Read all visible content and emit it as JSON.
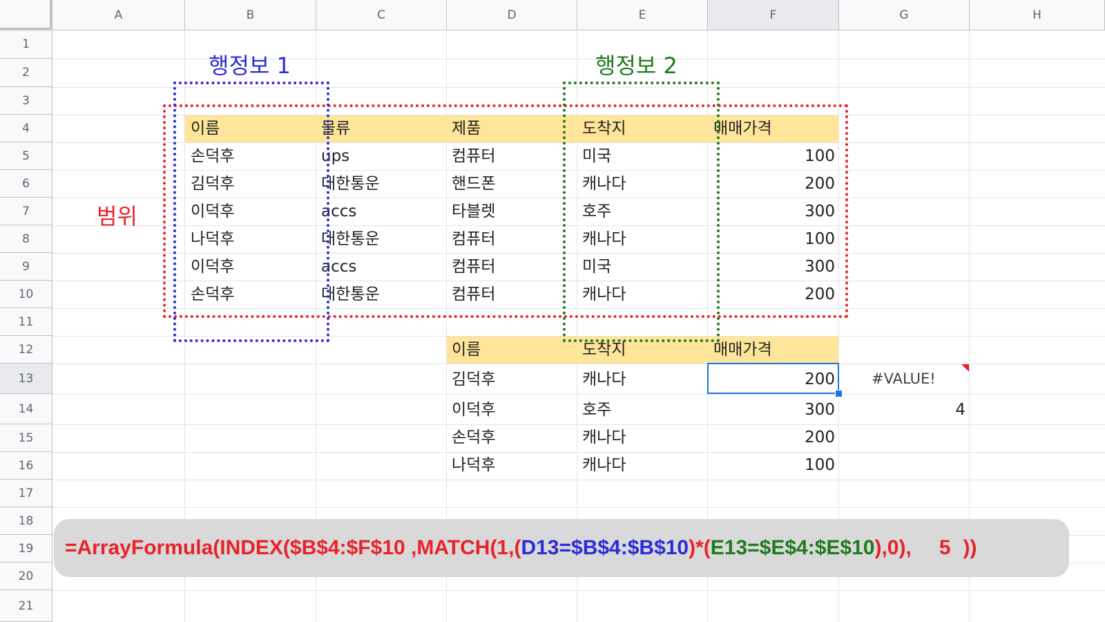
{
  "columns": [
    "A",
    "B",
    "C",
    "D",
    "E",
    "F",
    "G",
    "H"
  ],
  "rows": [
    "1",
    "2",
    "3",
    "4",
    "5",
    "6",
    "7",
    "8",
    "9",
    "10",
    "11",
    "12",
    "13",
    "14",
    "15",
    "16",
    "17",
    "18",
    "19",
    "20",
    "21"
  ],
  "labels": {
    "row_info_1": "행정보 1",
    "row_info_2": "행정보 2",
    "range": "범위"
  },
  "table1": {
    "headers": [
      "이름",
      "물류",
      "제품",
      "도착지",
      "매매가격"
    ],
    "rows": [
      [
        "손덕후",
        "ups",
        "컴퓨터",
        "미국",
        "100"
      ],
      [
        "김덕후",
        "대한통운",
        "핸드폰",
        "캐나다",
        "200"
      ],
      [
        "이덕후",
        "accs",
        "타블렛",
        "호주",
        "300"
      ],
      [
        "나덕후",
        "대한통운",
        "컴퓨터",
        "캐나다",
        "100"
      ],
      [
        "이덕후",
        "accs",
        "컴퓨터",
        "미국",
        "300"
      ],
      [
        "손덕후",
        "대한통운",
        "컴퓨터",
        "캐나다",
        "200"
      ]
    ]
  },
  "table2": {
    "headers": [
      "이름",
      "도착지",
      "매매가격"
    ],
    "rows": [
      [
        "김덕후",
        "캐나다",
        "200"
      ],
      [
        "이덕후",
        "호주",
        "300"
      ],
      [
        "손덕후",
        "캐나다",
        "200"
      ],
      [
        "나덕후",
        "캐나다",
        "100"
      ]
    ]
  },
  "extra": {
    "g13": "#VALUE!",
    "g14": "4"
  },
  "formula": {
    "p1": "=ArrayFormula(INDEX($B$4:$F$10 ,MATCH(1,(",
    "p2": "D13=$B$4:$B$10",
    "p3": ")*(",
    "p4": "E13=$E$4:$E$10",
    "p5": "),0),",
    "p6": "5",
    "p7": "))"
  },
  "colors": {
    "header_fill": "#ffe599",
    "range_box": "#e8222a",
    "row_info_1_box": "#2b2bd8",
    "row_info_2_box": "#1f7a1f",
    "selection": "#1a73e8"
  }
}
